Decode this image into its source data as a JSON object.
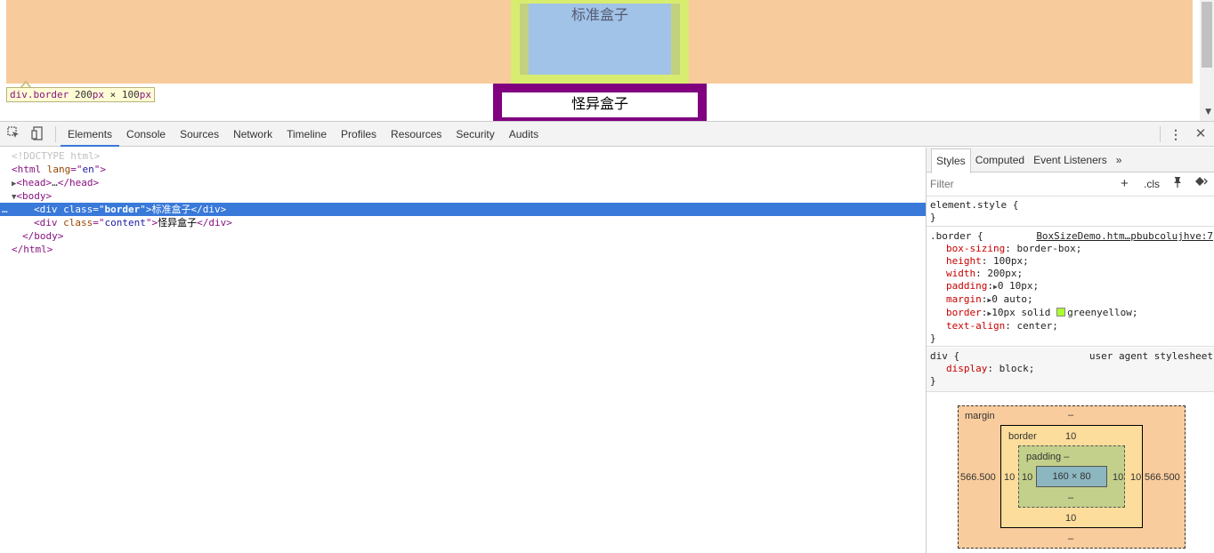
{
  "viewport": {
    "standard_box_text": "标准盒子",
    "quirk_box_text": "怪异盒子",
    "tooltip": {
      "selector": "div.border",
      "width": "200",
      "height": "100",
      "unit": "px",
      "times": "×"
    }
  },
  "devtools": {
    "tabs": [
      "Elements",
      "Console",
      "Sources",
      "Network",
      "Timeline",
      "Profiles",
      "Resources",
      "Security",
      "Audits"
    ],
    "active_tab": "Elements",
    "icons": {
      "inspect": "inspect-element-icon",
      "device": "device-mode-icon",
      "more": "more-vert-icon",
      "close": "close-icon"
    }
  },
  "elements_tree": {
    "doctype": "<!DOCTYPE html>",
    "html_open_tag": "html",
    "html_lang_attr": "lang",
    "html_lang_value": "en",
    "head_collapsed": "…",
    "head_tag": "head",
    "body_tag": "body",
    "div_tag": "div",
    "class_attr": "class",
    "div1_class": "border",
    "div1_text": "标准盒子",
    "div2_class": "content",
    "div2_text": "怪异盒子",
    "selected_ellipsis": "…"
  },
  "sidebar": {
    "tabs": [
      "Styles",
      "Computed",
      "Event Listeners"
    ],
    "active_tab": "Styles",
    "overflow": "»",
    "filter_placeholder": "Filter",
    "cls_label": ".cls",
    "element_style": "element.style {",
    "rule1": {
      "selector": ".border {",
      "source": "BoxSizeDemo.htm…pbubcolujhve:7",
      "props": [
        {
          "name": "box-sizing",
          "value": "border-box;"
        },
        {
          "name": "height",
          "value": "100px;"
        },
        {
          "name": "width",
          "value": "200px;"
        },
        {
          "name": "padding",
          "value": "0 10px;",
          "expand": true
        },
        {
          "name": "margin",
          "value": "0 auto;",
          "expand": true
        },
        {
          "name": "border",
          "value": "10px solid ",
          "expand": true,
          "color_name": "greenyellow;",
          "swatch": "#adff2f"
        },
        {
          "name": "text-align",
          "value": "center;"
        }
      ]
    },
    "rule2": {
      "selector": "div {",
      "source": "user agent stylesheet",
      "props": [
        {
          "name": "display",
          "value": "block;"
        }
      ]
    },
    "close_brace": "}"
  },
  "box_model": {
    "margin_label": "margin",
    "margin_top": "–",
    "margin_bottom": "–",
    "margin_left": "566.500",
    "margin_right": "566.500",
    "border_label": "border",
    "border_top": "10",
    "border_bottom": "10",
    "border_left": "10",
    "border_right": "10",
    "padding_label": "padding –",
    "padding_bottom": "–",
    "padding_left": "10",
    "padding_right": "10",
    "content": "160 × 80"
  },
  "colors": {
    "margin_overlay": "#f8cb9c",
    "border_overlay": "#d8ec70",
    "content_overlay": "#a1c3e8",
    "quirk_border": "#800080",
    "selection": "#3879d9"
  }
}
